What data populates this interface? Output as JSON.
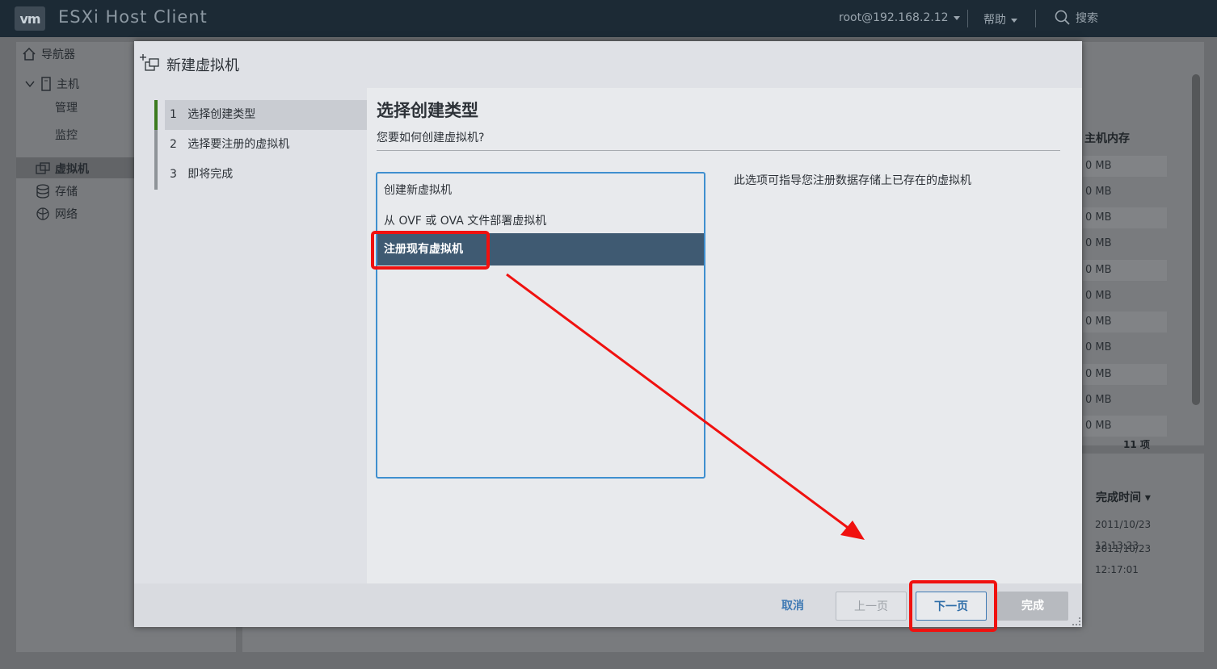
{
  "topbar": {
    "logo": "vm",
    "title": "ESXi Host Client",
    "user": "root@192.168.2.12",
    "help": "帮助",
    "search": "搜索"
  },
  "navigator": {
    "title": "导航器",
    "host": "主机",
    "manage": "管理",
    "monitor": "监控",
    "vms": "虚拟机",
    "storage": "存储",
    "network": "网络"
  },
  "background": {
    "memory_col": "主机内存",
    "mem_rows": [
      "0 MB",
      "0 MB",
      "0 MB",
      "0 MB",
      "0 MB",
      "0 MB",
      "0 MB",
      "0 MB",
      "0 MB",
      "0 MB",
      "0 MB"
    ],
    "count": "11 项",
    "complete_time_col": "完成时间 ▾",
    "times": [
      "2011/10/23 12:13:23",
      "2011/10/23 12:17:01"
    ]
  },
  "modal": {
    "title": "新建虚拟机",
    "steps": [
      {
        "num": "1",
        "label": "选择创建类型"
      },
      {
        "num": "2",
        "label": "选择要注册的虚拟机"
      },
      {
        "num": "3",
        "label": "即将完成"
      }
    ],
    "section_title": "选择创建类型",
    "section_subtitle": "您要如何创建虚拟机?",
    "options": [
      "创建新虚拟机",
      "从 OVF 或 OVA 文件部署虚拟机",
      "注册现有虚拟机"
    ],
    "selected_index": 2,
    "description": "此选项可指导您注册数据存储上已存在的虚拟机",
    "buttons": {
      "cancel": "取消",
      "prev": "上一页",
      "next": "下一页",
      "finish": "完成"
    }
  },
  "colors": {
    "highlight": "#f0110f",
    "selection": "#3f5a72",
    "accent": "#3f8fcf"
  }
}
